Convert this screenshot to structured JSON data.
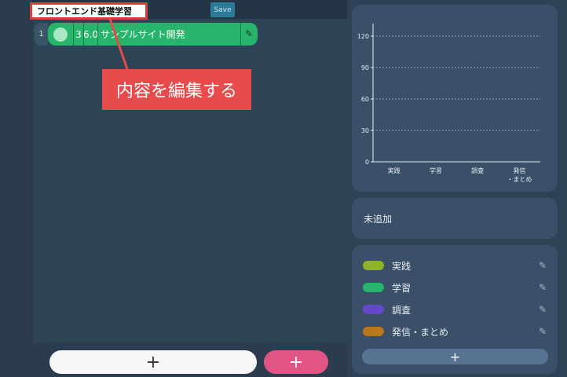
{
  "header": {
    "title": "フロントエンド基礎学習",
    "save_label": "Save"
  },
  "task": {
    "number": "1",
    "col_a": "3",
    "col_b": "6.0",
    "name": "サンプルサイト開発",
    "edit_icon": "pencil-icon"
  },
  "annotation": {
    "text": "内容を編集する"
  },
  "footer": {
    "add_label": "+",
    "add_pink_label": "+"
  },
  "status": {
    "text": "未追加"
  },
  "legend": {
    "items": [
      {
        "label": "実践",
        "color": "#8db524"
      },
      {
        "label": "学習",
        "color": "#27b46b"
      },
      {
        "label": "調査",
        "color": "#6547c9"
      },
      {
        "label": "発信・まとめ",
        "color": "#b87817"
      }
    ],
    "add_label": "+"
  },
  "chart_data": {
    "type": "bar",
    "categories": [
      "実践",
      "学習",
      "調査",
      "発信\n・まとめ"
    ],
    "values": [
      0,
      0,
      0,
      0
    ],
    "yticks": [
      "0",
      "30",
      "60",
      "90",
      "120"
    ],
    "ylim": [
      0,
      120
    ],
    "grid": true,
    "colors": [
      "#8db524",
      "#27b46b",
      "#6547c9",
      "#b87817"
    ]
  }
}
